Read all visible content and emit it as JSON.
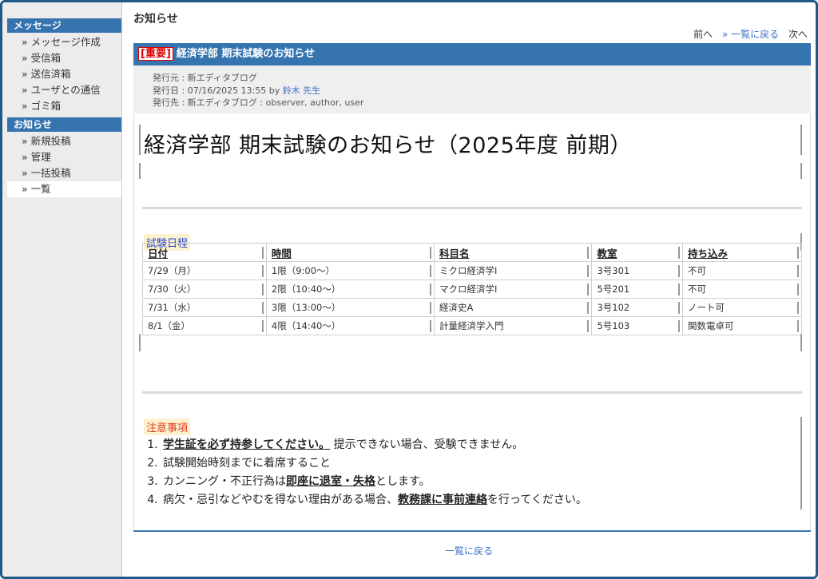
{
  "sidebar": {
    "message_header": "メッセージ",
    "message_items": [
      "» メッセージ作成",
      "» 受信箱",
      "» 送信済箱",
      "» ユーザとの通信",
      "» ゴミ箱"
    ],
    "notice_header": "お知らせ",
    "notice_items": [
      "» 新規投稿",
      "» 管理",
      "» 一括投稿",
      "» 一覧"
    ]
  },
  "page": {
    "title": "お知らせ",
    "nav_prev": "前へ",
    "nav_list": "» 一覧に戻る",
    "nav_next": "次へ",
    "bottom_link": "一覧に戻る"
  },
  "notice": {
    "badge": "[重要]",
    "heading": "経済学部 期末試験のお知らせ",
    "from_label": "発行元 : 新エディタブログ",
    "date_label": "発行日 : 07/16/2025 13:55 by",
    "author": "鈴木 先生",
    "to_label": "発行先 : 新エディタブログ : observer, author, user",
    "big_title": "経済学部 期末試験のお知らせ（2025年度 前期）",
    "schedule_label": "試験日程",
    "schedule": {
      "headers": [
        "日付",
        "時間",
        "科目名",
        "教室",
        "持ち込み"
      ],
      "rows": [
        [
          "7/29（月）",
          "1限（9:00〜）",
          "ミクロ経済学I",
          "3号301",
          "不可"
        ],
        [
          "7/30（火）",
          "2限（10:40〜）",
          "マクロ経済学I",
          "5号201",
          "不可"
        ],
        [
          "7/31（水）",
          "3限（13:00〜）",
          "経済史A",
          "3号102",
          "ノート可"
        ],
        [
          "8/1（金）",
          "4限（14:40〜）",
          "計量経済学入門",
          "5号103",
          "関数電卓可"
        ]
      ]
    },
    "notes_label": "注意事項",
    "notes": {
      "n1_bold": "学生証を必ず持参してください。",
      "n1_rest": "提示できない場合、受験できません。",
      "n2": "試験開始時刻までに着席すること",
      "n3_pre": "カンニング・不正行為は",
      "n3_bold": "即座に退室・失格",
      "n3_post": "とします。",
      "n4_pre": "病欠・忌引などやむを得ない理由がある場合、",
      "n4_bold": "教務課に事前連絡",
      "n4_post": "を行ってください。"
    }
  },
  "colors": {
    "accent": "#3674b0",
    "link": "#3a70c6",
    "important": "#e00000"
  }
}
